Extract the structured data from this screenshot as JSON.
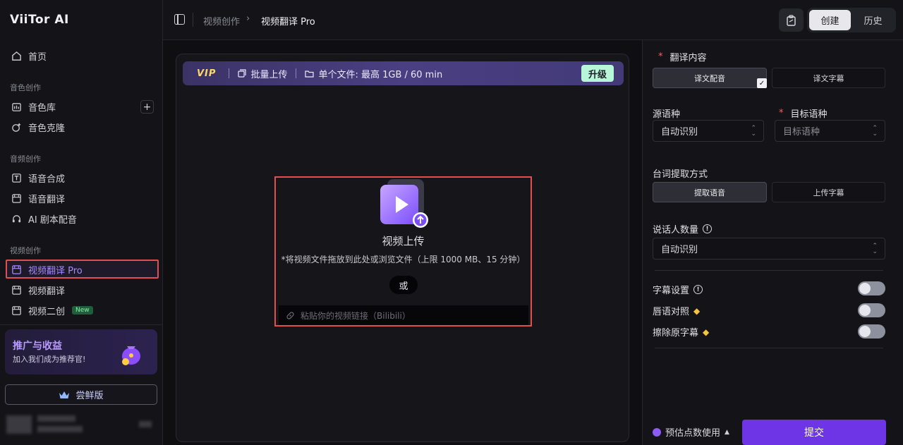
{
  "app": {
    "logo": "ViiTor AI"
  },
  "sidebar": {
    "home": "首页",
    "sections": [
      {
        "label": "音色创作",
        "items": [
          "音色库",
          "音色克隆"
        ]
      },
      {
        "label": "音频创作",
        "items": [
          "语音合成",
          "语音翻译",
          "AI 剧本配音"
        ]
      },
      {
        "label": "视频创作",
        "items": [
          "视频翻译 Pro",
          "视频翻译",
          "视频二创"
        ]
      }
    ],
    "new_badge": "New",
    "promo": {
      "title": "推广与收益",
      "subtitle": "加入我们成为推荐官!"
    },
    "plan_button": "尝鲜版"
  },
  "header": {
    "breadcrumb_parent": "视频创作",
    "breadcrumb_current": "视频翻译 Pro",
    "tabs": [
      {
        "label": "创建",
        "active": true
      },
      {
        "label": "历史",
        "active": false
      }
    ]
  },
  "vip_bar": {
    "vip": "VIP",
    "batch_upload": "批量上传",
    "single_file": "单个文件: 最高 1GB / 60 min",
    "upgrade": "升级"
  },
  "upload": {
    "title": "视频上传",
    "description": "*将视频文件拖放到此处或浏览文件（上限 1000 MB、15 分钟）",
    "or": "或",
    "link_placeholder": "粘贴你的视频链接（Bilibili）"
  },
  "settings": {
    "translate_content_label": "翻译内容",
    "translate_options": [
      {
        "label": "译文配音",
        "selected": true
      },
      {
        "label": "译文字幕",
        "selected": false
      }
    ],
    "source_lang_label": "源语种",
    "source_lang_value": "自动识别",
    "target_lang_label": "目标语种",
    "target_lang_placeholder": "目标语种",
    "extract_label": "台词提取方式",
    "extract_options": [
      {
        "label": "提取语音",
        "selected": true
      },
      {
        "label": "上传字幕",
        "selected": false
      }
    ],
    "speakers_label": "说话人数量",
    "speakers_value": "自动识别",
    "subtitle_settings": "字幕设置",
    "lip_sync": "唇语对照",
    "erase_subtitles": "擦除原字幕",
    "toggles": {
      "subtitle_settings": false,
      "lip_sync": false,
      "erase_subtitles": false
    }
  },
  "footer": {
    "estimate": "预估点数使用",
    "submit": "提交"
  },
  "colors": {
    "accent": "#6d35e6",
    "highlight": "#e05052",
    "active_nav": "#a788ff"
  }
}
